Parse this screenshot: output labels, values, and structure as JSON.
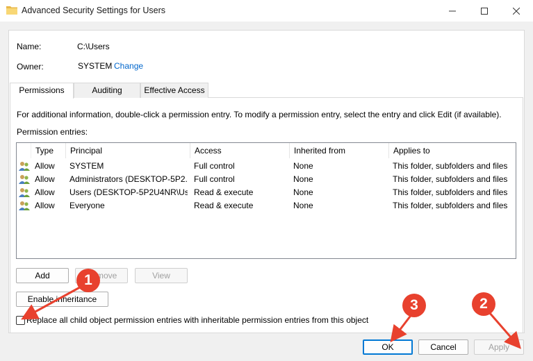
{
  "window": {
    "title": "Advanced Security Settings for Users",
    "controls": [
      "minimize-icon",
      "maximize-icon",
      "close-icon"
    ]
  },
  "header": {
    "name_label": "Name:",
    "name_value": "C:\\Users",
    "owner_label": "Owner:",
    "owner_value": "SYSTEM",
    "change_link": "Change"
  },
  "tabs": [
    {
      "label": "Permissions",
      "active": true
    },
    {
      "label": "Auditing",
      "active": false
    },
    {
      "label": "Effective Access",
      "active": false
    }
  ],
  "permissions": {
    "info_text": "For additional information, double-click a permission entry. To modify a permission entry, select the entry and click Edit (if available).",
    "entries_label": "Permission entries:",
    "columns": [
      "Type",
      "Principal",
      "Access",
      "Inherited from",
      "Applies to"
    ],
    "rows": [
      {
        "type": "Allow",
        "principal": "SYSTEM",
        "access": "Full control",
        "inherited": "None",
        "applies": "This folder, subfolders and files"
      },
      {
        "type": "Allow",
        "principal": "Administrators (DESKTOP-5P2...",
        "access": "Full control",
        "inherited": "None",
        "applies": "This folder, subfolders and files"
      },
      {
        "type": "Allow",
        "principal": "Users (DESKTOP-5P2U4NR\\Us...",
        "access": "Read & execute",
        "inherited": "None",
        "applies": "This folder, subfolders and files"
      },
      {
        "type": "Allow",
        "principal": "Everyone",
        "access": "Read & execute",
        "inherited": "None",
        "applies": "This folder, subfolders and files"
      }
    ]
  },
  "buttons": {
    "add": "Add",
    "remove": "Remove",
    "view": "View",
    "enable_inheritance": "Enable inheritance",
    "ok": "OK",
    "cancel": "Cancel",
    "apply": "Apply"
  },
  "replace_checkbox": {
    "label": "Replace all child object permission entries with inheritable permission entries from this object",
    "checked": false
  },
  "annotations": {
    "badge_1": "1",
    "badge_2": "2",
    "badge_3": "3",
    "color": "#e8412e"
  }
}
